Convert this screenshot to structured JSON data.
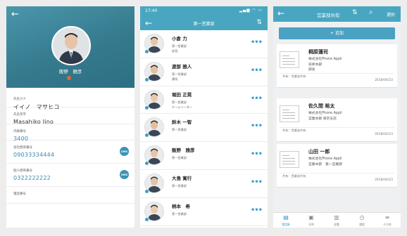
{
  "colors": {
    "accent": "#49a6c0",
    "link": "#3a86b5",
    "more": "#3aa0cc"
  },
  "profile": {
    "back_icon": "arrow-left-icon",
    "name": "飯野　雅彦",
    "fields": [
      {
        "label": "氏名カナ",
        "value": "イイノ　マサヒコ",
        "link": false,
        "sms": false
      },
      {
        "label": "氏名英字",
        "value": "Masahiko Iino",
        "link": false,
        "sms": false
      },
      {
        "label": "内線番号",
        "value": "3400",
        "link": true,
        "sms": false
      },
      {
        "label": "会社携帯番号",
        "value": "09033334444",
        "link": true,
        "sms": true
      },
      {
        "label": "個人携帯番号",
        "value": "0322222222",
        "link": true,
        "sms": true
      },
      {
        "label": "電話番号",
        "value": "",
        "link": false,
        "sms": false
      }
    ],
    "sms_label": "SMS"
  },
  "members": {
    "status_time": "17:40",
    "title": "第一営業部",
    "items": [
      {
        "name": "小倉 力",
        "dept": "第一営業部",
        "role": "部長"
      },
      {
        "name": "渡部 雅人",
        "dept": "第一営業部",
        "role": "課長"
      },
      {
        "name": "堀田 正晃",
        "dept": "第一営業部",
        "role": "チームリーダー"
      },
      {
        "name": "鈴木 一智",
        "dept": "第一営業部",
        "role": ""
      },
      {
        "name": "飯野　雅彦",
        "dept": "第一営業部",
        "role": ""
      },
      {
        "name": "大島 寛行",
        "dept": "第一営業部",
        "role": ""
      },
      {
        "name": "柄本　希",
        "dept": "第一営業部",
        "role": ""
      }
    ]
  },
  "shared": {
    "title": "営業部共有",
    "select_label": "選択",
    "add_label": "+ 追加",
    "cards": [
      {
        "name": "桐原蓮司",
        "company": "株式会社Phone Appli",
        "dept": "技術本部",
        "role": "部長",
        "share": "共有：営業部共有",
        "date": "2018/04/23"
      },
      {
        "name": "佐久間 裕太",
        "company": "株式会社Phone Appli",
        "dept": "営業本部 東京支店",
        "role": "",
        "share": "共有：営業部共有",
        "date": "2018/04/23"
      },
      {
        "name": "山田 一郎",
        "company": "株式会社Phone Appli",
        "dept": "営業本部　第一営業部",
        "role": "",
        "share": "共有：営業部共有",
        "date": "2018/04/23"
      }
    ],
    "tabs": [
      {
        "label": "電話帳",
        "icon": "contacts-icon",
        "active": true
      },
      {
        "label": "名刺",
        "icon": "business-card-icon",
        "active": false
      },
      {
        "label": "部署",
        "icon": "building-icon",
        "active": false
      },
      {
        "label": "履歴",
        "icon": "clock-icon",
        "active": false
      },
      {
        "label": "その他",
        "icon": "menu-icon",
        "active": false
      }
    ]
  }
}
